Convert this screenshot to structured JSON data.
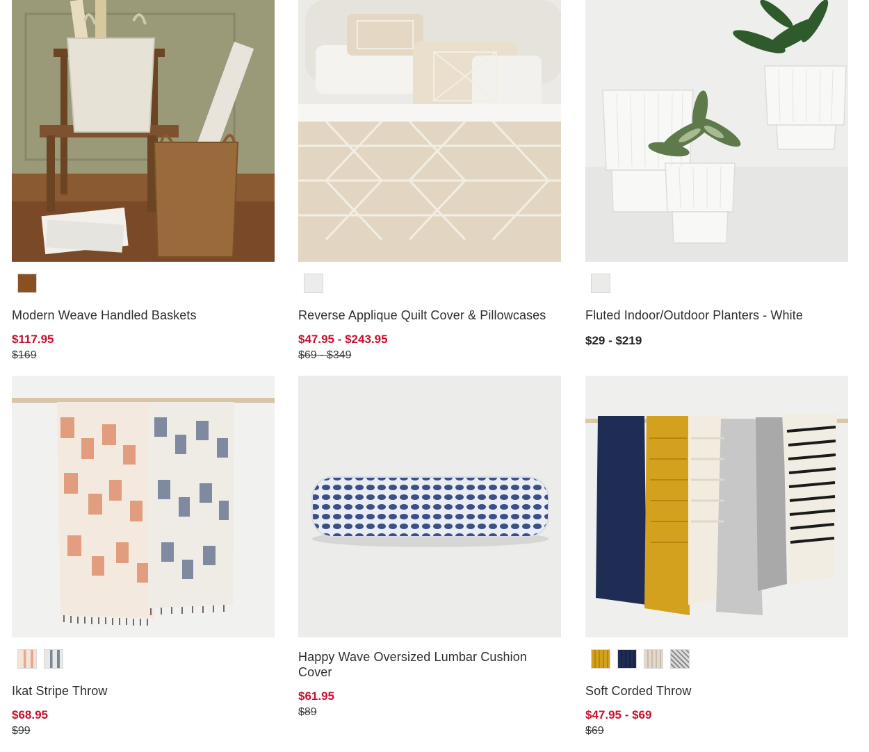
{
  "products": [
    {
      "name": "Modern Weave Handled Baskets",
      "sale_price": "$117.95",
      "original_price": "$169",
      "swatches": [
        "#8a5022"
      ],
      "image": "woven-baskets-photo"
    },
    {
      "name": "Reverse Applique Quilt Cover & Pillowcases",
      "sale_price": "$47.95 - $243.95",
      "original_price": "$69 - $349",
      "swatches": [
        "#ececec"
      ],
      "image": "quilt-bed-photo"
    },
    {
      "name": "Fluted Indoor/Outdoor Planters - White",
      "price": "$29 - $219",
      "swatches": [
        "#ebebe9"
      ],
      "image": "white-planters-photo"
    },
    {
      "name": "Ikat Stripe Throw",
      "sale_price": "$68.95",
      "original_price": "$99",
      "swatches": [
        "#e8b8a6",
        "#9aa3ac"
      ],
      "image": "ikat-throws-photo"
    },
    {
      "name": "Happy Wave Oversized Lumbar Cushion Cover",
      "sale_price": "$61.95",
      "original_price": "$89",
      "swatches": [],
      "image": "lumbar-cushion-photo"
    },
    {
      "name": "Soft Corded Throw",
      "sale_price": "$47.95 - $69",
      "original_price": "$69",
      "swatches": [
        "#d4a11e",
        "#1f2d52",
        "#d9cfc2",
        "#a8a8a8"
      ],
      "image": "corded-throws-photo"
    }
  ],
  "colors": {
    "sale": "#c8102e",
    "text": "#2e2e2e"
  }
}
